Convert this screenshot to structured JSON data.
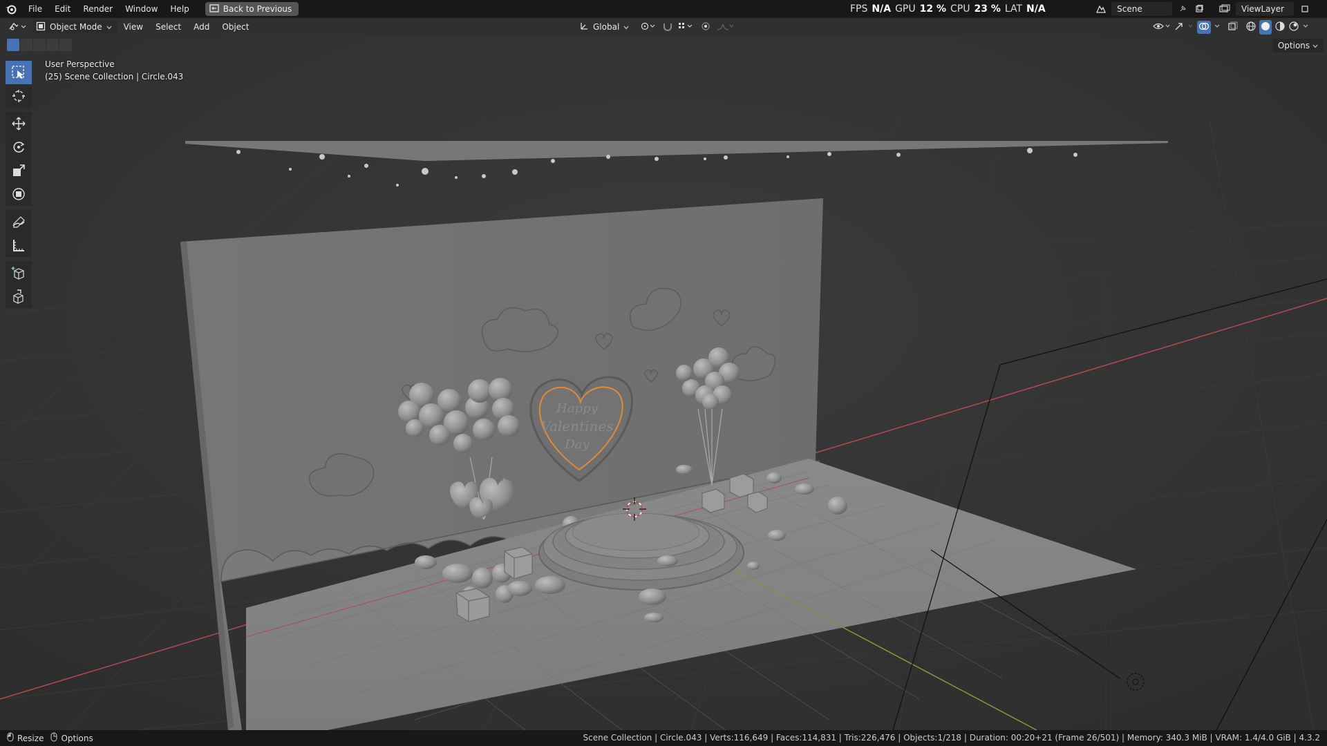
{
  "menu": {
    "file": "File",
    "edit": "Edit",
    "render": "Render",
    "window": "Window",
    "help": "Help",
    "back_to_previous": "Back to Previous"
  },
  "stats": {
    "fps_label": "FPS",
    "fps_value": "N/A",
    "gpu_label": "GPU",
    "gpu_value": "12 %",
    "cpu_label": "CPU",
    "cpu_value": "23 %",
    "lat_label": "LAT",
    "lat_value": "N/A"
  },
  "scene": {
    "name": "Scene"
  },
  "view_layer": {
    "name": "ViewLayer"
  },
  "viewport_header": {
    "mode": "Object Mode",
    "view": "View",
    "select": "Select",
    "add": "Add",
    "object": "Object",
    "orientation": "Global",
    "options": "Options"
  },
  "viewport": {
    "perspective": "User Perspective",
    "collection_info": "(25) Scene Collection | Circle.043"
  },
  "statusbar": {
    "left_action": "Resize",
    "left_options": "Options",
    "info": "Scene Collection | Circle.043 | Verts:116,649 | Faces:114,831 | Tris:226,476 | Objects:1/218 | Duration: 00:20+21 (Frame 26/501) | Memory: 340.3 MiB | VRAM: 1.4/4.0 GiB | 4.3.2"
  },
  "icons": {
    "logo": "blender-logo-icon",
    "tools": [
      "select-box-icon",
      "cursor-icon",
      "move-icon",
      "rotate-icon",
      "scale-icon",
      "transform-icon",
      "annotate-icon",
      "measure-icon",
      "add-cube-icon",
      "extrude-icon"
    ]
  },
  "colors": {
    "accent": "#4772b3",
    "x_axis": "#b34a50",
    "y_axis": "#7a9a3a",
    "selection_outline": "#e08a3c"
  }
}
